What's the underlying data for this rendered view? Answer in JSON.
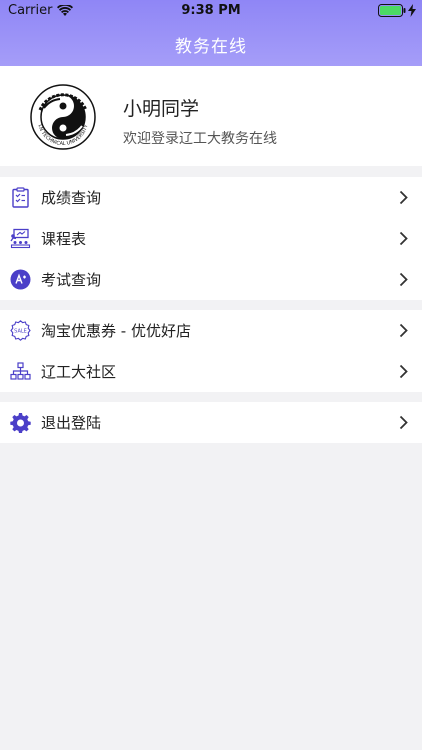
{
  "status_bar": {
    "carrier": "Carrier",
    "time": "9:38 PM"
  },
  "nav": {
    "title": "教务在线"
  },
  "profile": {
    "name": "小明同学",
    "subtitle": "欢迎登录辽工大教务在线",
    "logo_text": "LN TECHNICAL UNIVERSITY"
  },
  "groups": [
    {
      "items": [
        {
          "label": "成绩查询",
          "icon": "clipboard-checklist-icon"
        },
        {
          "label": "课程表",
          "icon": "classroom-icon"
        },
        {
          "label": "考试查询",
          "icon": "exam-circle-icon"
        }
      ]
    },
    {
      "items": [
        {
          "label": "淘宝优惠券 - 优优好店",
          "icon": "sale-badge-icon"
        },
        {
          "label": "辽工大社区",
          "icon": "org-chart-icon"
        }
      ]
    },
    {
      "items": [
        {
          "label": "退出登陆",
          "icon": "gear-icon"
        }
      ]
    }
  ],
  "colors": {
    "header_top": "#8f86f6",
    "header_bottom": "#a59df8",
    "icon_accent": "#4b3fc8",
    "background": "#f2f2f4"
  }
}
